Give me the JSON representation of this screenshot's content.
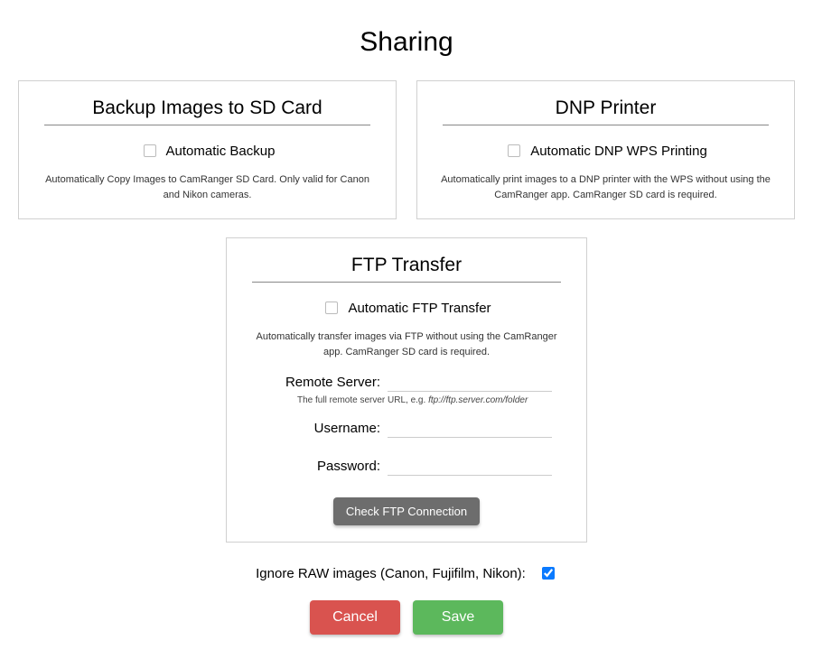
{
  "title": "Sharing",
  "backup": {
    "title": "Backup Images to SD Card",
    "checkbox_label": "Automatic Backup",
    "desc": "Automatically Copy Images to CamRanger SD Card. Only valid for Canon and Nikon cameras."
  },
  "dnp": {
    "title": "DNP Printer",
    "checkbox_label": "Automatic DNP WPS Printing",
    "desc": "Automatically print images to a DNP printer with the WPS without using the CamRanger app. CamRanger SD card is required."
  },
  "ftp": {
    "title": "FTP Transfer",
    "checkbox_label": "Automatic FTP Transfer",
    "desc": "Automatically transfer images via FTP without using the CamRanger app. CamRanger SD card is required.",
    "remote_label": "Remote Server:",
    "remote_helper_prefix": "The full remote server URL, e.g. ",
    "remote_helper_example": "ftp://ftp.server.com/folder",
    "username_label": "Username:",
    "password_label": "Password:",
    "check_button": "Check FTP Connection"
  },
  "ignore_raw_label": "Ignore RAW images (Canon, Fujifilm, Nikon):",
  "ignore_raw_checked": true,
  "buttons": {
    "cancel": "Cancel",
    "save": "Save"
  }
}
